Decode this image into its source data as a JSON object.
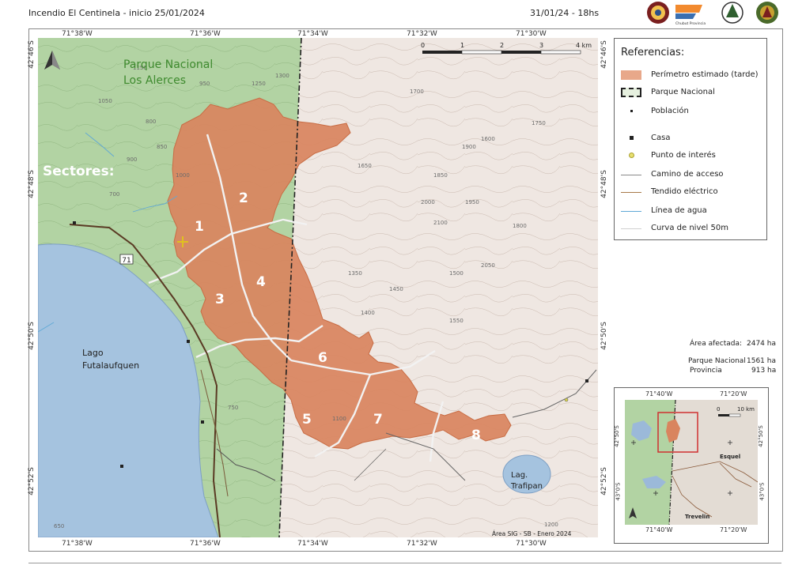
{
  "header": {
    "title": "Incendio El Centinela  -  inicio 25/01/2024",
    "date": "31/01/24 - 18hs"
  },
  "logos": [
    "brigada-logo",
    "chubut-provincia-logo",
    "parques-logo",
    "bomberos-logo"
  ],
  "logo_text": "Chubut Provincia",
  "map": {
    "top_coords": [
      "71°38'W",
      "71°36'W",
      "71°34'W",
      "71°32'W",
      "71°30'W"
    ],
    "bottom_coords": [
      "71°38'W",
      "71°36'W",
      "71°34'W",
      "71°32'W",
      "71°30'W"
    ],
    "left_coords": [
      "42°46'S",
      "42°48'S",
      "42°50'S",
      "42°52'S"
    ],
    "right_coords": [
      "42°46'S",
      "42°48'S",
      "42°50'S",
      "42°52'S"
    ],
    "park_label_1": "Parque Nacional",
    "park_label_2": "Los Alerces",
    "sectors_title": "Sectores:",
    "sectors": [
      "1",
      "2",
      "3",
      "4",
      "5",
      "6",
      "7",
      "8"
    ],
    "lake_1": "Lago",
    "lake_2": "Futalaufquen",
    "lag_1": "Lag.",
    "lag_2": "Trafipan",
    "route": "71",
    "scale_ticks": [
      "0",
      "1",
      "2",
      "3",
      "4 km"
    ],
    "credit": "Área SIG - SB - Enero 2024",
    "contour_labels": [
      "1050",
      "1150",
      "1250",
      "1300",
      "1350",
      "1400",
      "1450",
      "1500",
      "1550",
      "1600",
      "1650",
      "1700",
      "1750",
      "1800",
      "1850",
      "1900",
      "1950",
      "2000",
      "2050",
      "2100",
      "800",
      "850",
      "900",
      "950",
      "1000",
      "700",
      "750",
      "650",
      "1100",
      "1200"
    ]
  },
  "legend": {
    "title": "Referencias:",
    "items": [
      {
        "label": "Perímetro estimado (tarde)",
        "icon": "fire-perimeter-swatch"
      },
      {
        "label": "Parque Nacional",
        "icon": "park-boundary-swatch"
      },
      {
        "label": "Población",
        "icon": "population-point"
      },
      {
        "label": "Casa",
        "icon": "house-point"
      },
      {
        "label": "Punto de interés",
        "icon": "poi-point"
      },
      {
        "label": "Camino de acceso",
        "icon": "road-line"
      },
      {
        "label": "Tendido eléctrico",
        "icon": "power-line"
      },
      {
        "label": "Línea de agua",
        "icon": "water-line"
      },
      {
        "label": "Curva de nivel 50m",
        "icon": "contour-line"
      }
    ]
  },
  "stats": {
    "area_label": "Área afectada:",
    "area_value": "2474 ha",
    "park_label": "Parque Nacional",
    "park_value": "1561 ha",
    "prov_label": "Provincia",
    "prov_value": "913 ha"
  },
  "inset": {
    "top_coords": [
      "71°40'W",
      "71°20'W"
    ],
    "bottom_coords": [
      "71°40'W",
      "71°20'W"
    ],
    "left_coords": [
      "42°50'S",
      "43°0'S"
    ],
    "right_coords": [
      "42°50'S",
      "43°0'S"
    ],
    "scale_ticks": [
      "0",
      "10 km"
    ],
    "place_1": "Esquel",
    "place_2": "Trevelin"
  },
  "colors": {
    "fire": "#d9845e",
    "park_green": "#a9cf9b",
    "terrain": "#efe6e0",
    "lake": "#9bb9d9",
    "road": "#7a5a3a",
    "boundary": "#222222"
  }
}
